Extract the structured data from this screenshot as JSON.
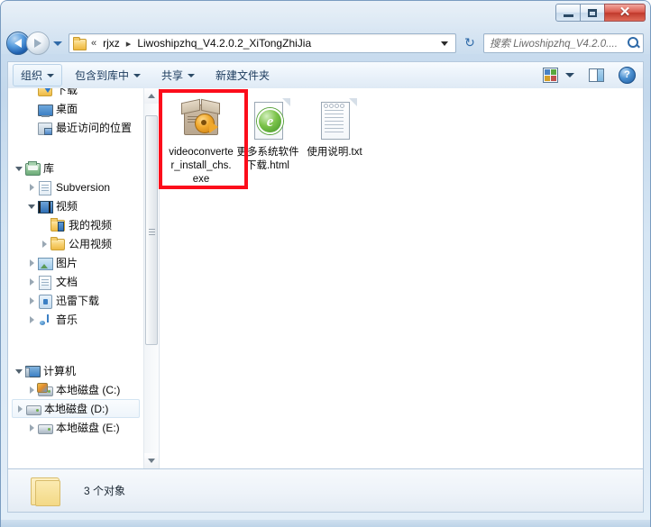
{
  "window": {
    "title": "",
    "buttons": {
      "minimize_label": "–",
      "maximize_label": "",
      "close_label": "✕"
    }
  },
  "navbar": {
    "back_tooltip": "后退",
    "forward_tooltip": "前进",
    "breadcrumb": {
      "overflow": "«",
      "items": [
        "rjxz",
        "Liwoshipzhq_V4.2.0.2_XiTongZhiJia"
      ],
      "separator": "▸"
    },
    "refresh_label": "↻",
    "search": {
      "placeholder": "搜索 Liwoshipzhq_V4.2.0....",
      "value": ""
    }
  },
  "toolbar": {
    "items": [
      {
        "label": "组织",
        "has_caret": true,
        "active": true
      },
      {
        "label": "包含到库中",
        "has_caret": true,
        "active": false
      },
      {
        "label": "共享",
        "has_caret": true,
        "active": false
      },
      {
        "label": "新建文件夹",
        "has_caret": false,
        "active": false
      }
    ],
    "view_caret": "",
    "help_label": "?"
  },
  "sidebar": {
    "items": [
      {
        "label": "下载",
        "icon": "download-folder-icon",
        "indent": 2,
        "twisty": "none",
        "selected": false
      },
      {
        "label": "桌面",
        "icon": "desktop-icon",
        "indent": 2,
        "twisty": "none",
        "selected": false
      },
      {
        "label": "最近访问的位置",
        "icon": "recent-places-icon",
        "indent": 2,
        "twisty": "none",
        "selected": false
      },
      {
        "label": "库",
        "icon": "library-icon",
        "indent": 1,
        "twisty": "open",
        "selected": false,
        "gap_before": true
      },
      {
        "label": "Subversion",
        "icon": "document-icon",
        "indent": 2,
        "twisty": "closed",
        "selected": false
      },
      {
        "label": "视频",
        "icon": "video-library-icon",
        "indent": 2,
        "twisty": "open",
        "selected": false
      },
      {
        "label": "我的视频",
        "icon": "video-folder-icon",
        "indent": 3,
        "twisty": "none",
        "selected": false
      },
      {
        "label": "公用视频",
        "icon": "public-video-folder-icon",
        "indent": 3,
        "twisty": "closed",
        "selected": false
      },
      {
        "label": "图片",
        "icon": "pictures-icon",
        "indent": 2,
        "twisty": "closed",
        "selected": false
      },
      {
        "label": "文档",
        "icon": "documents-icon",
        "indent": 2,
        "twisty": "closed",
        "selected": false
      },
      {
        "label": "迅雷下载",
        "icon": "thunder-download-icon",
        "indent": 2,
        "twisty": "closed",
        "selected": false
      },
      {
        "label": "音乐",
        "icon": "music-icon",
        "indent": 2,
        "twisty": "closed",
        "selected": false
      },
      {
        "label": "计算机",
        "icon": "computer-icon",
        "indent": 1,
        "twisty": "open",
        "selected": false,
        "gap_before": true
      },
      {
        "label": "本地磁盘 (C:)",
        "icon": "system-disk-icon",
        "indent": 2,
        "twisty": "closed",
        "selected": false
      },
      {
        "label": "本地磁盘 (D:)",
        "icon": "harddisk-icon",
        "indent": 2,
        "twisty": "closed",
        "selected": true
      },
      {
        "label": "本地磁盘 (E:)",
        "icon": "harddisk-icon",
        "indent": 2,
        "twisty": "closed",
        "selected": false
      }
    ]
  },
  "files": {
    "items": [
      {
        "name": "videoconverter_install_chs.exe",
        "icon": "installer-package-icon",
        "highlighted": true
      },
      {
        "name": "更多系统软件下载.html",
        "icon": "html-document-icon",
        "ie_glyph": "e",
        "highlighted": false
      },
      {
        "name": "使用说明.txt",
        "icon": "text-document-icon",
        "highlighted": false
      }
    ]
  },
  "statusbar": {
    "text": "3 个对象"
  },
  "colors": {
    "highlight_rect": "#fc0d1b",
    "frame": "#c3d8ec",
    "accent": "#2f6aa8",
    "close_button": "#c03a2c"
  }
}
